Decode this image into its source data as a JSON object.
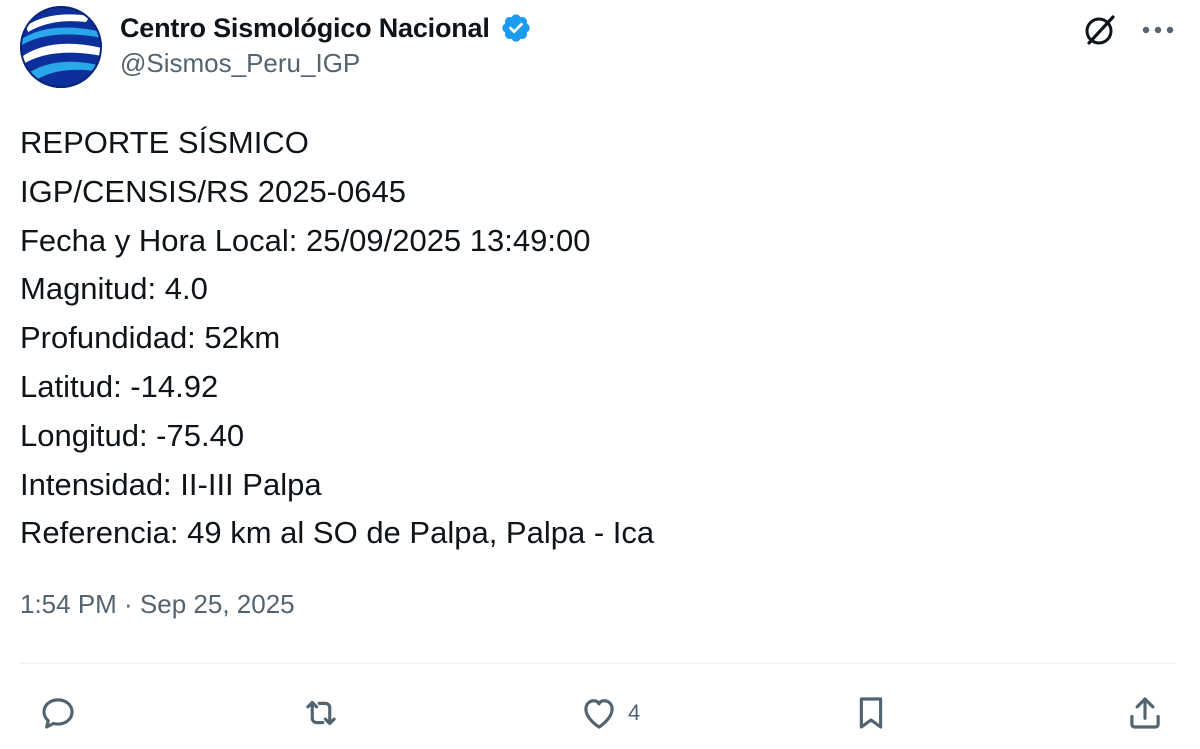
{
  "author": {
    "display_name": "Centro Sismológico Nacional",
    "handle": "@Sismos_Peru_IGP",
    "verified": true,
    "avatar_icon": "igp-globe-logo-icon"
  },
  "tweet": {
    "lines": [
      "REPORTE SÍSMICO",
      "IGP/CENSIS/RS 2025-0645",
      "Fecha y Hora Local: 25/09/2025 13:49:00",
      "Magnitud: 4.0",
      "Profundidad: 52km",
      "Latitud: -14.92",
      "Longitud: -75.40",
      "Intensidad: II-III Palpa",
      "Referencia: 49 km al SO de Palpa, Palpa - Ica"
    ],
    "timestamp": "1:54 PM · Sep 25, 2025"
  },
  "actions": {
    "reply_icon": "reply-icon",
    "retweet_icon": "retweet-icon",
    "like_icon": "like-heart-icon",
    "like_count": "4",
    "bookmark_icon": "bookmark-icon",
    "share_icon": "share-icon"
  },
  "header_icons": {
    "grok": "grok-icon",
    "more": "more-options-icon"
  },
  "colors": {
    "text_primary": "#0f1419",
    "text_secondary": "#536471",
    "verified_blue": "#1d9bf0",
    "divider": "#eff3f4"
  }
}
